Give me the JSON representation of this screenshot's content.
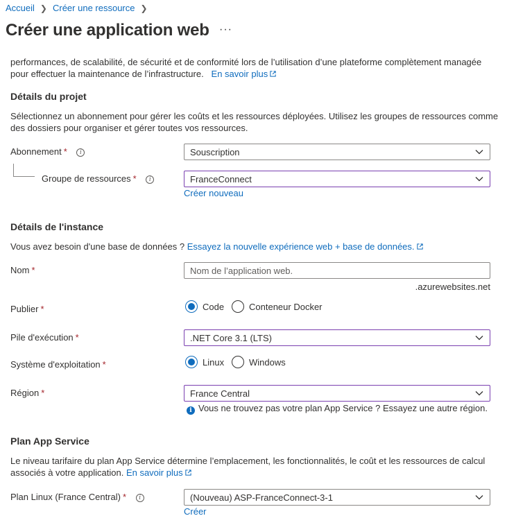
{
  "breadcrumb": {
    "home": "Accueil",
    "current": "Créer une ressource"
  },
  "page": {
    "title": "Créer une application web",
    "more": "···"
  },
  "intro": {
    "line1": "performances, de scalabilité, de sécurité et de conformité lors de l’utilisation d’une plateforme complètement managée",
    "line2": "pour effectuer la maintenance de l’infrastructure.",
    "learn_more": "En savoir plus"
  },
  "project": {
    "heading": "Détails du projet",
    "desc1": "Sélectionnez un abonnement pour gérer les coûts et les ressources déployées. Utilisez les groupes de ressources comme",
    "desc2": "des dossiers pour organiser et gérer toutes vos ressources.",
    "subscription_label": "Abonnement",
    "subscription_value": "Souscription",
    "rg_label": "Groupe de ressources",
    "rg_value": "FranceConnect",
    "create_new": "Créer nouveau"
  },
  "instance": {
    "heading": "Détails de l'instance",
    "db_question": "Vous avez besoin d'une base de données ?",
    "db_link": "Essayez la nouvelle expérience web + base de données.",
    "name_label": "Nom",
    "name_placeholder": "Nom de l’application web.",
    "name_suffix": ".azurewebsites.net",
    "publish_label": "Publier",
    "publish_options": [
      "Code",
      "Conteneur Docker"
    ],
    "publish_selected": "Code",
    "stack_label": "Pile d'exécution",
    "stack_value": ".NET Core 3.1 (LTS)",
    "os_label": "Système d'exploitation",
    "os_options": [
      "Linux",
      "Windows"
    ],
    "os_selected": "Linux",
    "region_label": "Région",
    "region_value": "France Central",
    "region_note": "Vous ne trouvez pas votre plan App Service ? Essayez une autre région."
  },
  "plan": {
    "heading": "Plan App Service",
    "desc1": "Le niveau tarifaire du plan App Service détermine l’emplacement, les fonctionnalités, le coût et les ressources de calcul",
    "desc2": "associés à votre application.",
    "learn_more": "En savoir plus",
    "linux_plan_label": "Plan Linux (France Central)",
    "linux_plan_value": "(Nouveau) ASP-FranceConnect-3-1",
    "create": "Créer"
  },
  "required_mark": "*",
  "colors": {
    "link": "#0f6cbd",
    "required": "#a4262c",
    "focus_border": "#7a3fb0",
    "text": "#323130"
  }
}
